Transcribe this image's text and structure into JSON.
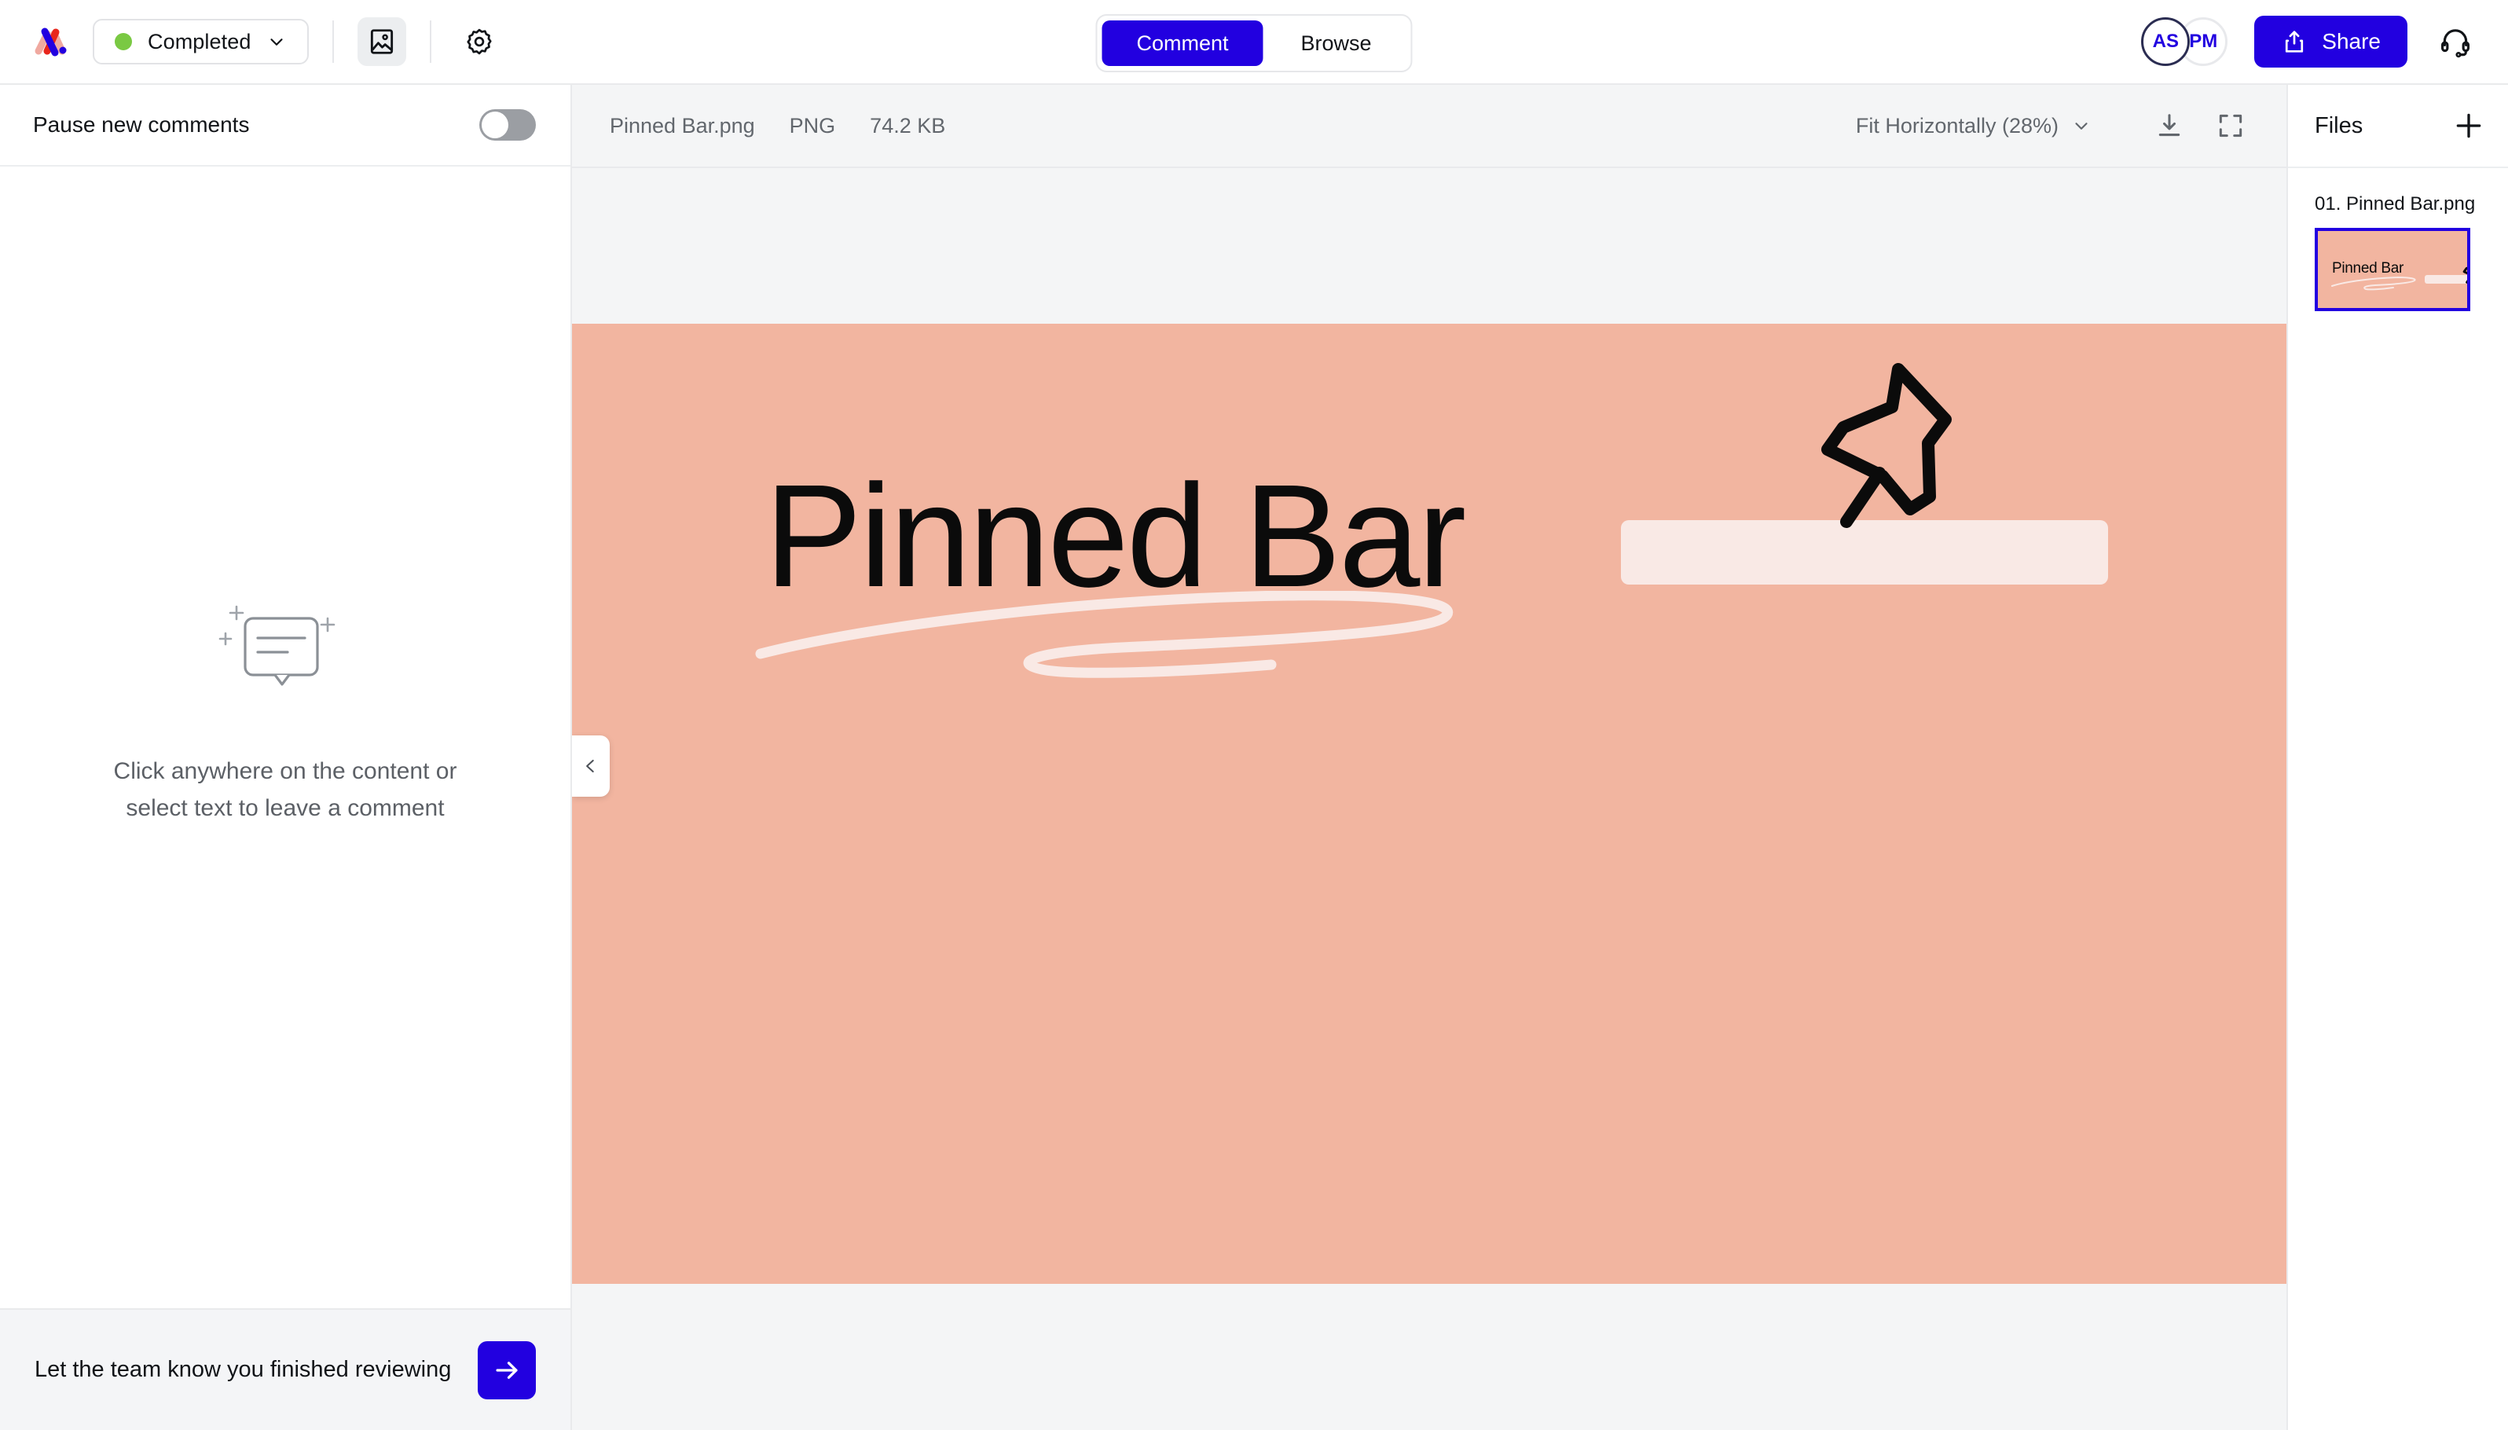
{
  "header": {
    "logo_alt": "markup-logo",
    "status": {
      "label": "Completed",
      "dot_color": "#7ac943"
    },
    "image_mode_icon": "image-icon",
    "settings_icon": "gear-icon",
    "tabs": [
      {
        "label": "Comment",
        "active": true
      },
      {
        "label": "Browse",
        "active": false
      }
    ],
    "avatars": [
      {
        "initials": "AS"
      },
      {
        "initials": "PM"
      }
    ],
    "share_label": "Share",
    "share_icon": "share-upload-icon",
    "support_icon": "headset-icon",
    "accent_color": "#2200e0"
  },
  "sidebar": {
    "pause_label": "Pause new comments",
    "pause_enabled": false,
    "empty_icon": "comment-bubble-sparkle-icon",
    "empty_line1": "Click anywhere on the content or",
    "empty_line2": "select text to leave a comment",
    "finish_text": "Let the team know you finished reviewing",
    "finish_icon": "arrow-right-icon"
  },
  "filebar": {
    "name": "Pinned Bar.png",
    "type": "PNG",
    "size": "74.2 KB",
    "zoom_label": "Fit Horizontally (28%)",
    "download_icon": "download-icon",
    "fullscreen_icon": "expand-icon",
    "collapse_icon": "chevron-left-icon"
  },
  "artboard": {
    "background": "#f2b5a0",
    "title": "Pinned Bar",
    "bar_color": "#f9e9e5",
    "squiggle_color": "#f9e9e5",
    "pin_icon": "pushpin-icon"
  },
  "files": {
    "title": "Files",
    "add_icon": "plus-icon",
    "items": [
      {
        "label": "01. Pinned Bar.png",
        "thumb_title": "Pinned Bar",
        "selected": true
      }
    ]
  }
}
